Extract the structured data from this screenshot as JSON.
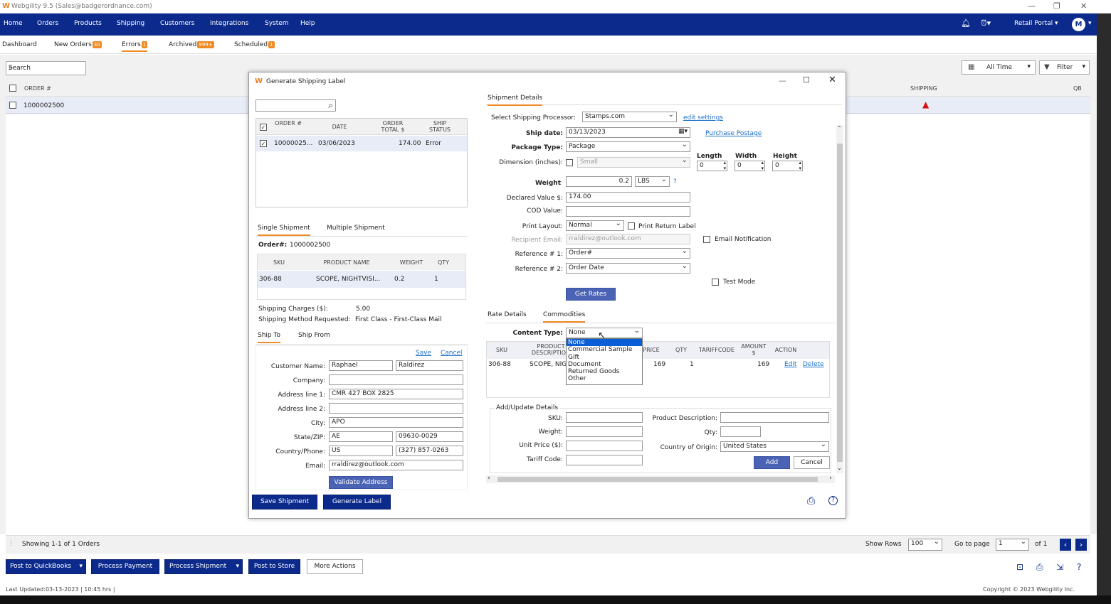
{
  "window": {
    "title": "Webgility 9.5 (Sales@badgerordnance.com)",
    "controls": [
      "—",
      "❐",
      "✕"
    ]
  },
  "nav": {
    "items": [
      "Home",
      "Orders",
      "Products",
      "Shipping",
      "Customers",
      "Integrations",
      "System",
      "Help"
    ],
    "portal": "Retail Portal",
    "avatar": "M"
  },
  "subtabs": [
    {
      "label": "Dashboard",
      "badge": ""
    },
    {
      "label": "New Orders",
      "badge": "30"
    },
    {
      "label": "Errors",
      "badge": "1"
    },
    {
      "label": "Archived",
      "badge": "999+"
    },
    {
      "label": "Scheduled",
      "badge": "1"
    }
  ],
  "toolbar": {
    "search_placeholder": "Search",
    "time_filter": "All Time",
    "filter_label": "Filter"
  },
  "grid": {
    "columns": {
      "order": "ORDER #",
      "shipping": "SHIPPING",
      "qb": "QB"
    },
    "rows": [
      {
        "order": "1000002500"
      }
    ]
  },
  "pager": {
    "showing": "Showing 1-1 of 1 Orders",
    "show_rows_label": "Show Rows",
    "rows_value": "100",
    "go_to_page_label": "Go to page",
    "page_value": "1",
    "of_label": "of 1"
  },
  "actions": {
    "post_qb": "Post to QuickBooks",
    "process_payment": "Process Payment",
    "process_shipment": "Process Shipment",
    "post_store": "Post to Store",
    "more_actions": "More Actions"
  },
  "footer": {
    "last_updated": "Last Updated:03-13-2023 | 10:45 hrs |",
    "copyright": "Copyright © 2023 Webgility Inc."
  },
  "dialog": {
    "title": "Generate Shipping Label",
    "order_table": {
      "headers": [
        "ORDER #",
        "DATE",
        "ORDER TOTAL $",
        "SHIP STATUS"
      ],
      "row": {
        "order": "10000025...",
        "date": "03/06/2023",
        "total": "174.00",
        "status": "Error"
      }
    },
    "shipment_tabs": [
      "Single Shipment",
      "Multiple Shipment"
    ],
    "order_num_label": "Order#:",
    "order_num": "1000002500",
    "items_table": {
      "headers": [
        "SKU",
        "PRODUCT NAME",
        "WEIGHT",
        "QTY"
      ],
      "row": {
        "sku": "306-88",
        "name": "SCOPE, NIGHTVISI...",
        "weight": "0.2",
        "qty": "1"
      }
    },
    "shipping_charges_label": "Shipping Charges ($):",
    "shipping_charges": "5.00",
    "shipping_method_label": "Shipping Method Requested:",
    "shipping_method": "First Class - First-Class Mail",
    "address_tabs": [
      "Ship To",
      "Ship From"
    ],
    "save_link": "Save",
    "cancel_link": "Cancel",
    "address": {
      "customer_name_label": "Customer Name:",
      "first_name": "Raphael",
      "last_name": "Raldirez",
      "company_label": "Company:",
      "company": "",
      "address1_label": "Address line 1:",
      "address1": "CMR 427 BOX 2825",
      "address2_label": "Address line 2:",
      "address2": "",
      "city_label": "City:",
      "city": "APO",
      "statezip_label": "State/ZIP:",
      "state": "AE",
      "zip": "09630-0029",
      "countryphone_label": "Country/Phone:",
      "country": "US",
      "phone": "(327) 857-0263",
      "email_label": "Email:",
      "email": "rraldirez@outlook.com"
    },
    "validate_button": "Validate Address",
    "save_shipment_button": "Save Shipment",
    "generate_label_button": "Generate Label",
    "shipment_details_tab": "Shipment Details",
    "details": {
      "processor_label": "Select Shipping Processor:",
      "processor": "Stamps.com",
      "edit_settings": "edit settings",
      "ship_date_label": "Ship date:",
      "ship_date": "03/13/2023",
      "purchase_postage": "Purchase Postage",
      "package_type_label": "Package Type:",
      "package_type": "Package",
      "dimension_label": "Dimension (inches):",
      "dimension_value": "Small",
      "length_label": "Length",
      "width_label": "Width",
      "height_label": "Height",
      "length": "0",
      "width": "0",
      "height": "0",
      "weight_label": "Weight",
      "weight": "0.2",
      "weight_unit": "LBS",
      "help_mark": "?",
      "declared_label": "Declared Value $:",
      "declared": "174.00",
      "cod_label": "COD Value:",
      "cod": "",
      "print_layout_label": "Print Layout:",
      "print_layout": "Normal",
      "print_return_label": "Print Return Label",
      "recipient_email_label": "Recipient Email:",
      "recipient_email": "rraldirez@outlook.com",
      "email_notification": "Email Notification",
      "ref1_label": "Reference # 1:",
      "ref1": "Order#",
      "ref2_label": "Reference # 2:",
      "ref2": "Order Date",
      "test_mode": "Test Mode",
      "get_rates": "Get Rates"
    },
    "lower_tabs": [
      "Rate Details",
      "Commodities"
    ],
    "content_type_label": "Content Type:",
    "content_type": "None",
    "content_type_options": [
      "None",
      "Commercial Sample",
      "Gift",
      "Document",
      "Returned Goods",
      "Other"
    ],
    "commodities_table": {
      "headers": [
        "SKU",
        "PRODUCT DESCRIPTION",
        "PRICE",
        "QTY",
        "TARIFFCODE",
        "AMOUNT $",
        "ACTION"
      ],
      "row": {
        "sku": "306-88",
        "desc": "SCOPE, NIG",
        "price": "169",
        "qty": "1",
        "tariff": "",
        "amount": "169",
        "edit": "Edit",
        "delete": "Delete"
      }
    },
    "add_update": {
      "legend": "Add/Update Details",
      "sku_label": "SKU:",
      "product_desc_label": "Product Description:",
      "weight_label": "Weight:",
      "qty_label": "Qty:",
      "unit_price_label": "Unit Price ($):",
      "country_label": "Country of Origin:",
      "country": "United States",
      "tariff_label": "Tariff Code:",
      "add": "Add",
      "cancel": "Cancel"
    }
  }
}
